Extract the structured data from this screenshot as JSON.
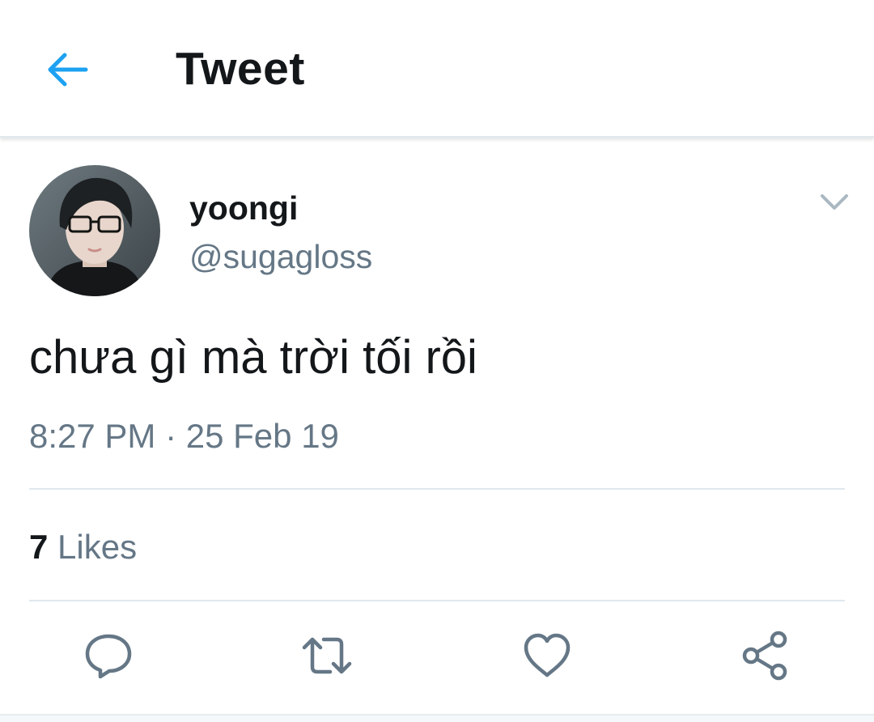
{
  "header": {
    "back_icon": "arrow-left-icon",
    "title": "Tweet",
    "accent_color": "#1da1f2"
  },
  "tweet": {
    "author": {
      "display_name": "yoongi",
      "handle": "@sugagloss",
      "avatar": "avatar-photo"
    },
    "menu_icon": "chevron-down-icon",
    "text": "chưa gì mà trời tối rồi",
    "time": "8:27 PM",
    "separator": "·",
    "date": "25 Feb 19",
    "likes": {
      "count": "7",
      "label": "Likes"
    }
  },
  "actions": [
    {
      "name": "reply",
      "icon": "reply-icon"
    },
    {
      "name": "retweet",
      "icon": "retweet-icon"
    },
    {
      "name": "like",
      "icon": "heart-icon"
    },
    {
      "name": "share",
      "icon": "share-icon"
    }
  ],
  "colors": {
    "text_primary": "#14171a",
    "text_secondary": "#657786",
    "divider": "#e1e8ed",
    "icon": "#657786"
  }
}
